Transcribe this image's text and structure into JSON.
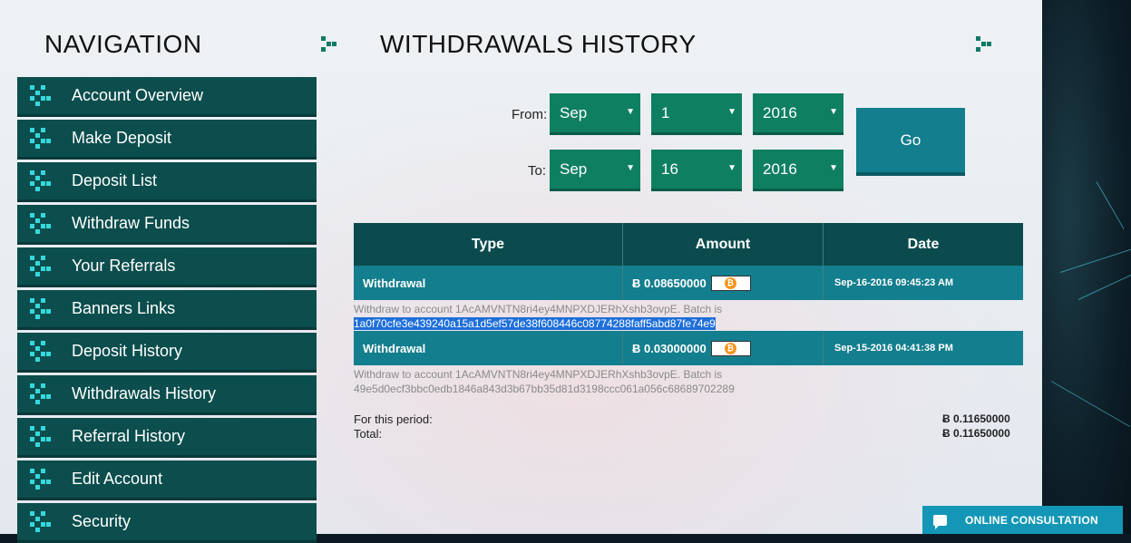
{
  "navigation": {
    "title": "NAVIGATION",
    "items": [
      {
        "label": "Account Overview"
      },
      {
        "label": "Make Deposit"
      },
      {
        "label": "Deposit List"
      },
      {
        "label": "Withdraw Funds"
      },
      {
        "label": "Your Referrals"
      },
      {
        "label": "Banners Links"
      },
      {
        "label": "Deposit History"
      },
      {
        "label": "Withdrawals History"
      },
      {
        "label": "Referral History"
      },
      {
        "label": "Edit Account"
      },
      {
        "label": "Security"
      }
    ]
  },
  "main": {
    "title": "WITHDRAWALS HISTORY",
    "filter": {
      "from_label": "From:",
      "to_label": "To:",
      "from_month": "Sep",
      "from_day": "1",
      "from_year": "2016",
      "to_month": "Sep",
      "to_day": "16",
      "to_year": "2016",
      "dropdown_arrow": "▼",
      "go_label": "Go"
    },
    "table": {
      "headers": {
        "type": "Type",
        "amount": "Amount",
        "date": "Date"
      },
      "rows": [
        {
          "type": "Withdrawal",
          "amount": "Ƀ 0.08650000",
          "date": "Sep-16-2016 09:45:23 AM",
          "detail_prefix": "Withdraw to account 1AcAMVNTN8ri4ey4MNPXDJERhXshb3ovpE. Batch is",
          "batch": "1a0f70cfe3e439240a15a1d5ef57de38f608446c08774288faff5abd87fe74e9"
        },
        {
          "type": "Withdrawal",
          "amount": "Ƀ 0.03000000",
          "date": "Sep-15-2016 04:41:38 PM",
          "detail_prefix": "Withdraw to account 1AcAMVNTN8ri4ey4MNPXDJERhXshb3ovpE. Batch is",
          "batch": "49e5d0ecf3bbc0edb1846a843d3b67bb35d81d3198ccc061a056c68689702289"
        }
      ],
      "coin_glyph": "₿"
    },
    "summary": {
      "period_label": "For this period:",
      "period_value": "Ƀ 0.11650000",
      "total_label": "Total:",
      "total_value": "Ƀ 0.11650000"
    }
  },
  "consultation": {
    "label": "ONLINE CONSULTATION"
  },
  "colors": {
    "nav_bg": "#0c4d4d",
    "nav_icon": "#35d9dd",
    "select_bg": "#0f7f62",
    "table_header": "#0b4b4e",
    "table_row": "#137e8d",
    "consult_bg": "#1497b6"
  },
  "icons": {
    "nav_item_icon": "pixel-grid-icon",
    "heading_decor": "pixel-decor-icon",
    "amount_badge": "bitcoin-icon",
    "consult_icon": "chat-bubble-icon"
  }
}
